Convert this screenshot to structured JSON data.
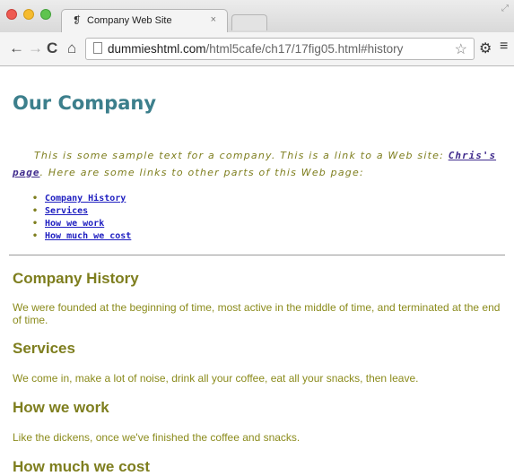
{
  "browser": {
    "tab_title": "Company Web Site",
    "tab_close": "×",
    "url_domain": "dummieshtml.com",
    "url_path": "/html5cafe/ch17/17fig05.html#history",
    "icons": {
      "back": "back-arrow-icon",
      "forward": "forward-arrow-icon",
      "reload": "reload-icon",
      "home": "home-icon",
      "bookmark": "star-icon",
      "settings": "gear-icon",
      "menu": "hamburger-menu-icon"
    }
  },
  "page": {
    "heading": "Our Company",
    "intro_before_link": "This is some sample text for a company. This is a link to a Web site: ",
    "intro_link": "Chris's page",
    "intro_after_link": ". Here are some links to other parts of this Web page:",
    "toc": [
      "Company History",
      "Services",
      "How we work",
      "How much we cost"
    ],
    "sections": [
      {
        "title": "Company History",
        "text": "We were founded at the beginning of time, most active in the middle of time, and terminated at the end of time."
      },
      {
        "title": "Services",
        "text": "We come in, make a lot of noise, drink all your coffee, eat all your snacks, then leave."
      },
      {
        "title": "How we work",
        "text": "Like the dickens, once we've finished the coffee and snacks."
      },
      {
        "title": "How much we cost",
        "text": ""
      }
    ]
  },
  "colors": {
    "heading_teal": "#3c7f8c",
    "olive_text": "#7e7e1e",
    "link_blue": "#1e1ec0",
    "link_purple": "#3f2a8c"
  }
}
